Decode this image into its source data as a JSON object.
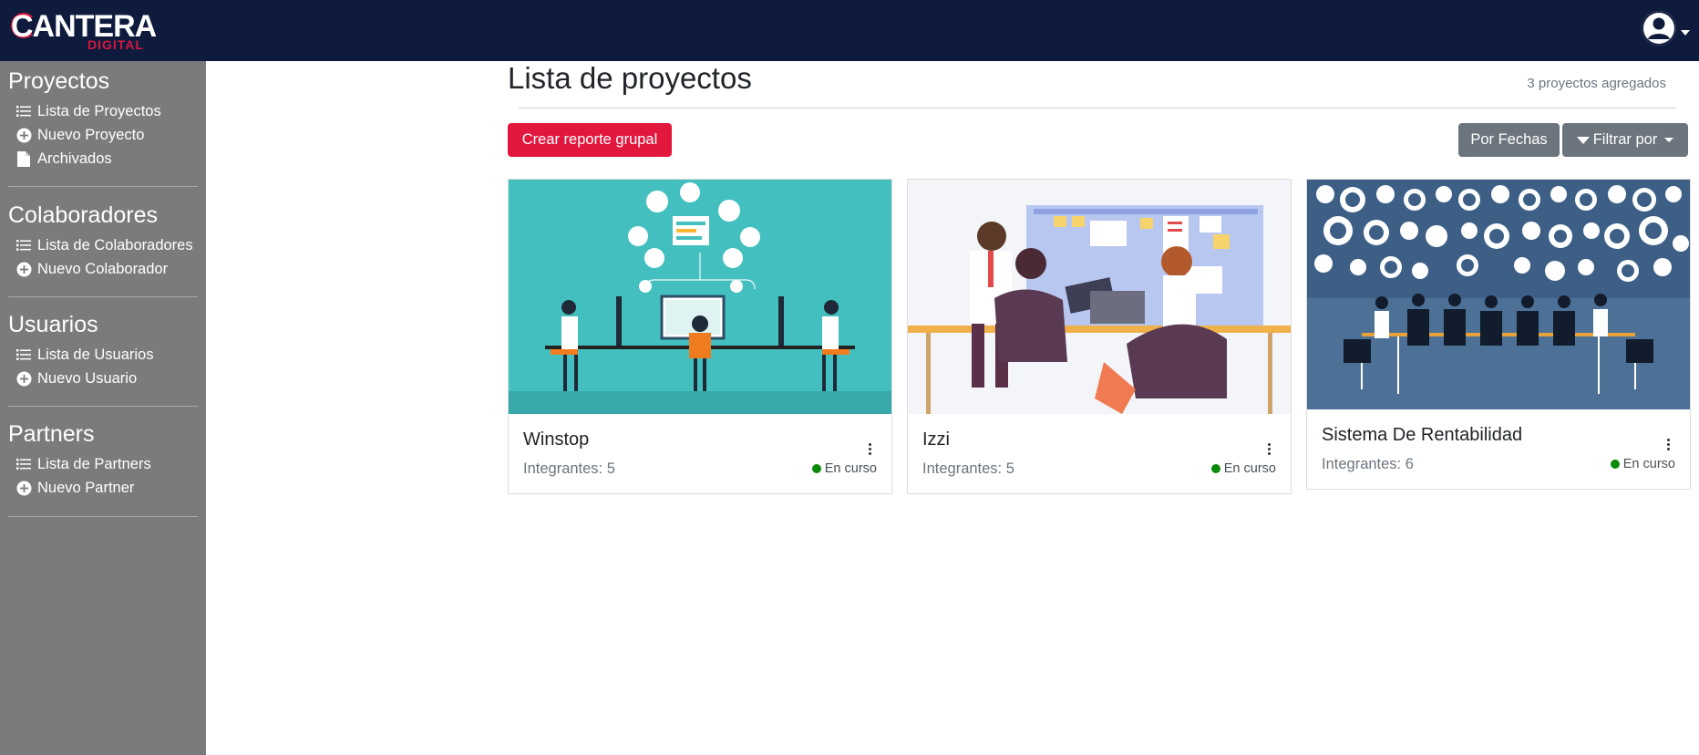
{
  "header": {
    "logo_text": "CANTERA",
    "logo_subtext": "DIGITAL"
  },
  "sidebar": {
    "sections": [
      {
        "title": "Proyectos",
        "items": [
          {
            "label": "Lista de Proyectos",
            "icon": "list-icon"
          },
          {
            "label": "Nuevo Proyecto",
            "icon": "plus-circle-icon"
          },
          {
            "label": "Archivados",
            "icon": "document-icon"
          }
        ]
      },
      {
        "title": "Colaboradores",
        "items": [
          {
            "label": "Lista de Colaboradores",
            "icon": "list-icon"
          },
          {
            "label": "Nuevo Colaborador",
            "icon": "plus-circle-icon"
          }
        ]
      },
      {
        "title": "Usuarios",
        "items": [
          {
            "label": "Lista de Usuarios",
            "icon": "list-icon"
          },
          {
            "label": "Nuevo Usuario",
            "icon": "plus-circle-icon"
          }
        ]
      },
      {
        "title": "Partners",
        "items": [
          {
            "label": "Lista de Partners",
            "icon": "list-icon"
          },
          {
            "label": "Nuevo Partner",
            "icon": "plus-circle-icon"
          }
        ]
      }
    ]
  },
  "main": {
    "title": "Lista de proyectos",
    "count_text": "3 proyectos agregados",
    "create_report_label": "Crear reporte grupal",
    "by_dates_label": "Por Fechas",
    "filter_label": "Filtrar por"
  },
  "projects": [
    {
      "name": "Winstop",
      "members": "Integrantes: 5",
      "status": "En curso"
    },
    {
      "name": "Izzi",
      "members": "Integrantes: 5",
      "status": "En curso"
    },
    {
      "name": "Sistema De Rentabilidad",
      "members": "Integrantes: 6",
      "status": "En curso"
    }
  ],
  "colors": {
    "topbar": "#0e1b3c",
    "sidebar": "#7b7b7b",
    "primary_red": "#e2173e",
    "secondary_grey": "#6c757d",
    "status_green": "#0a8a0a"
  }
}
